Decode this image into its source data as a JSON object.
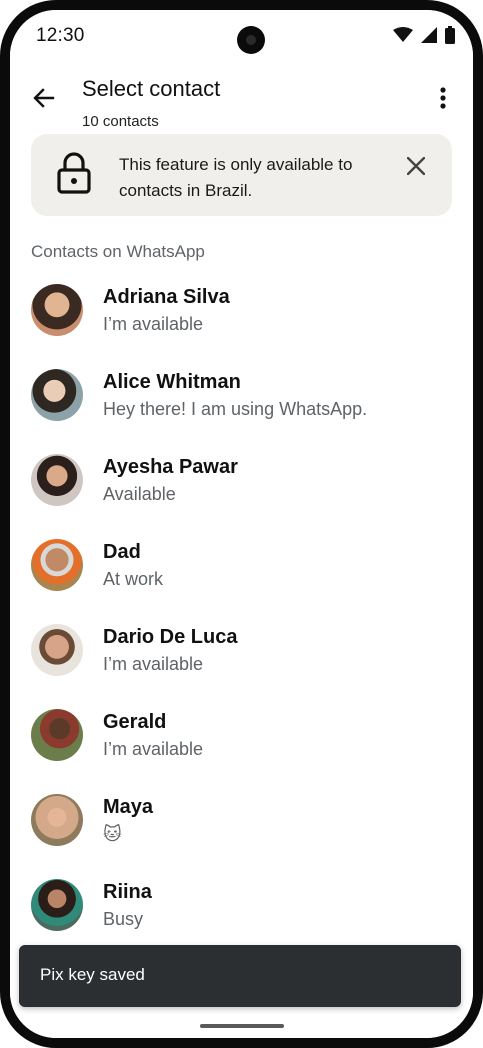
{
  "status_bar": {
    "time": "12:30",
    "icons": [
      "wifi-icon",
      "signal-icon",
      "battery-icon"
    ]
  },
  "app_bar": {
    "title": "Select contact",
    "subtitle": "10 contacts",
    "back_icon": "arrow-back-icon",
    "menu_icon": "more-vert-icon"
  },
  "banner": {
    "icon": "lock-icon",
    "text": "This feature is only available to contacts in Brazil.",
    "close_icon": "close-icon",
    "background": "#f1efec"
  },
  "section_header": "Contacts on WhatsApp",
  "contacts": [
    {
      "name": "Adriana Silva",
      "status": "I’m available",
      "avatar_color": "#c98e6e"
    },
    {
      "name": "Alice Whitman",
      "status": "Hey there! I am using WhatsApp.",
      "avatar_color": "#8da2a8"
    },
    {
      "name": "Ayesha Pawar",
      "status": "Available",
      "avatar_color": "#cfc6c1"
    },
    {
      "name": "Dad",
      "status": "At work",
      "avatar_color": "#a9854f"
    },
    {
      "name": "Dario De Luca",
      "status": "I’m available",
      "avatar_color": "#b98f74"
    },
    {
      "name": "Gerald",
      "status": "I’m available",
      "avatar_color": "#6a7d4a"
    },
    {
      "name": "Maya",
      "status": "🐱",
      "avatar_color": "#d4a98a"
    },
    {
      "name": "Riina",
      "status": "Busy",
      "avatar_color": "#4d6b5c"
    }
  ],
  "snackbar": {
    "text": "Pix key saved"
  },
  "colors": {
    "primary_text": "#111111",
    "secondary_text": "#5f6368",
    "snackbar_bg": "#2b2f32",
    "device_frame": "#0b0b0b"
  }
}
